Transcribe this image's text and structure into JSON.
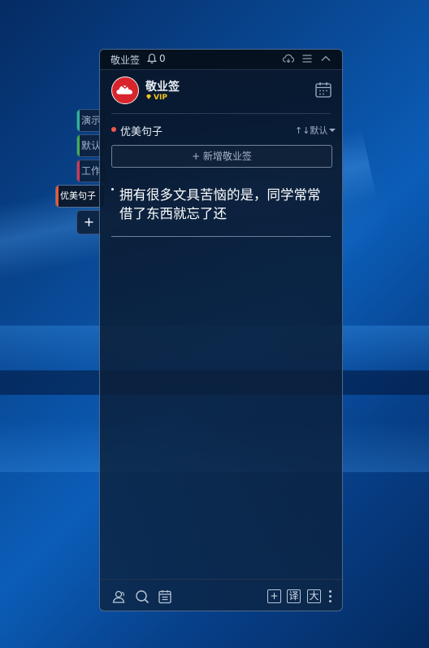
{
  "titlebar": {
    "app_name": "敬业签",
    "notification_count": "0",
    "icons": [
      "bell-icon",
      "cloud-sync-icon",
      "menu-icon",
      "collapse-icon"
    ]
  },
  "profile": {
    "name": "敬业签",
    "badge": "VIP",
    "avatar_color": "#d8252b",
    "badge_color": "#f3c21c"
  },
  "side_tabs": [
    {
      "label": "演示",
      "color": "#2bb5a4"
    },
    {
      "label": "默认",
      "color": "#3fae57"
    },
    {
      "label": "工作",
      "color": "#d2385a"
    },
    {
      "label": "优美句子",
      "color": "#e85a3d",
      "active": true
    },
    {
      "label": "+"
    }
  ],
  "category": {
    "name": "优美句子",
    "dot_color": "#f05a4b",
    "sort_label": "↑↓默认"
  },
  "add_note_label": "+ 新增敬业签",
  "notes": [
    {
      "text": "拥有很多文具苦恼的是，同学常常借了东西就忘了还"
    }
  ],
  "footer": {
    "icons": [
      "contacts-icon",
      "search-icon",
      "notes-list-icon",
      "add-box-icon",
      "translate-icon",
      "font-size-icon",
      "more-icon"
    ],
    "add_box": "+",
    "translate": "译",
    "font_size": "大"
  }
}
